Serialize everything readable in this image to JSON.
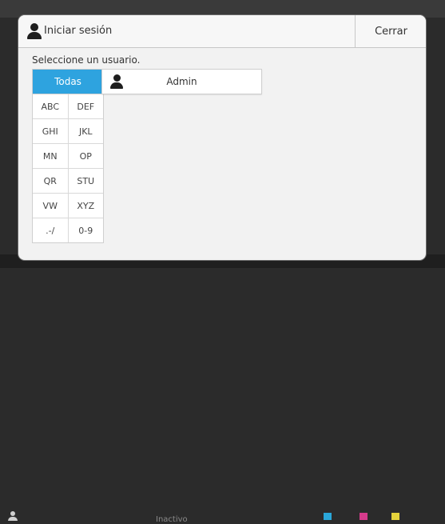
{
  "background": {
    "status": "Inactivo",
    "toner_colors": [
      "#3b6fd6",
      "#2aa7d9",
      "#d63b8c",
      "#e4d23b"
    ]
  },
  "dialog": {
    "title": "Iniciar sesión",
    "close_label": "Cerrar",
    "title_icon": "user-icon"
  },
  "instruction": "Seleccione un usuario.",
  "filters": {
    "all": "Todas",
    "rows": [
      [
        "ABC",
        "DEF"
      ],
      [
        "GHI",
        "JKL"
      ],
      [
        "MN",
        "OP"
      ],
      [
        "QR",
        "STU"
      ],
      [
        "VW",
        "XYZ"
      ],
      [
        ".-/",
        "0-9"
      ]
    ],
    "selected": "Todas",
    "accent_color": "#2ea3df"
  },
  "users": [
    {
      "name": "Admin",
      "icon": "user-icon"
    }
  ]
}
